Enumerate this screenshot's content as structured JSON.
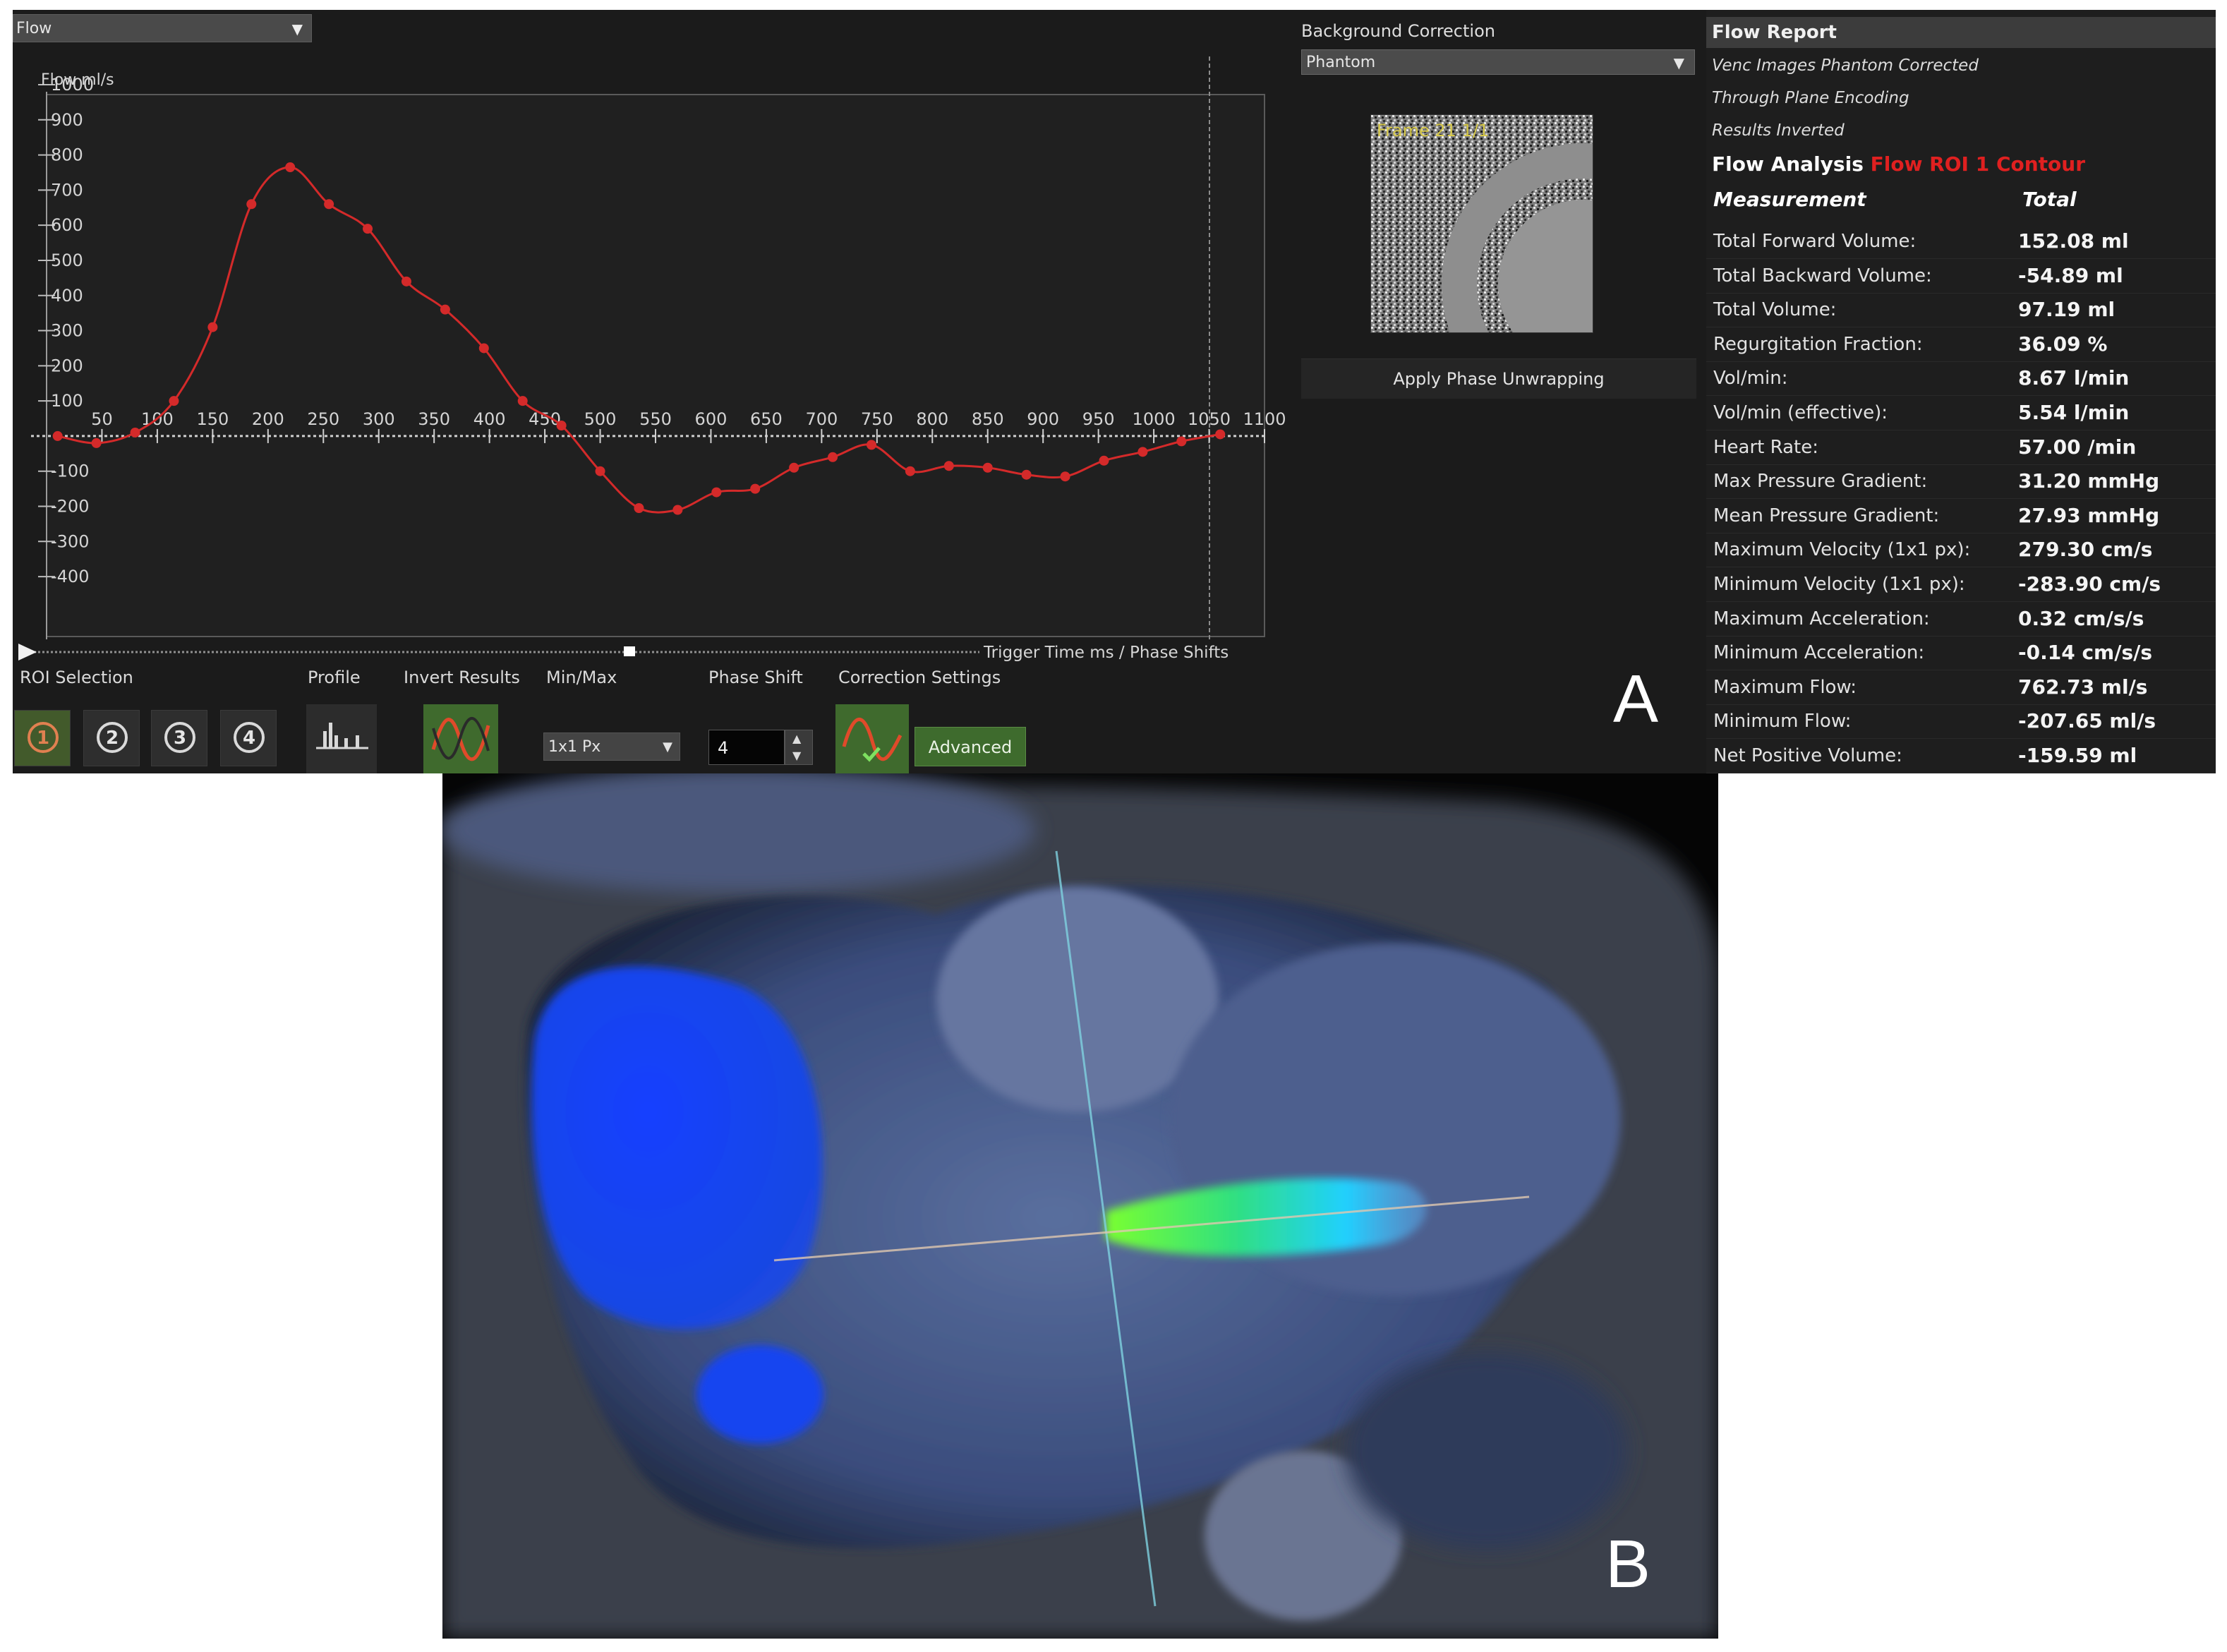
{
  "mode_select": {
    "value": "Flow"
  },
  "chart_data": {
    "type": "line",
    "title": "",
    "ylabel": "Flow ml/s",
    "xlabel": "Trigger Time ms / Phase Shifts",
    "xlim": [
      0,
      1100
    ],
    "ylim": [
      -450,
      1000
    ],
    "x_ticks": [
      50,
      100,
      150,
      200,
      250,
      300,
      350,
      400,
      450,
      500,
      550,
      600,
      650,
      700,
      750,
      800,
      850,
      900,
      950,
      1000,
      1050,
      1100
    ],
    "x_tick_labels": [
      "50",
      "100",
      "150",
      "200",
      "250",
      "300",
      "350",
      "400",
      "450",
      "500",
      "550",
      "600",
      "650",
      "700",
      "750",
      "800",
      "850",
      "900",
      "950",
      "1000",
      "1050",
      "1100"
    ],
    "y_ticks": [
      1000,
      900,
      800,
      700,
      600,
      500,
      400,
      300,
      200,
      100,
      -100,
      -200,
      -300,
      -400
    ],
    "y_tick_labels": [
      "1000",
      "900",
      "800",
      "700",
      "600",
      "500",
      "400",
      "300",
      "200",
      "100",
      "-100",
      "-200",
      "-300",
      "-400"
    ],
    "series": [
      {
        "color": "#d42a2a",
        "x": [
          10,
          45,
          80,
          115,
          150,
          185,
          220,
          255,
          290,
          325,
          360,
          395,
          430,
          465,
          500,
          535,
          570,
          605,
          640,
          675,
          710,
          745,
          780,
          815,
          850,
          885,
          920,
          955,
          990,
          1025,
          1060
        ],
        "values": [
          0,
          -20,
          10,
          100,
          310,
          660,
          765,
          660,
          590,
          440,
          360,
          250,
          100,
          30,
          -100,
          -205,
          -210,
          -160,
          -150,
          -90,
          -60,
          -25,
          -100,
          -85,
          -90,
          -110,
          -115,
          -70,
          -45,
          -15,
          5
        ]
      }
    ],
    "grid": false,
    "legend": "none"
  },
  "bg_correction": {
    "label": "Background Correction",
    "value": "Phantom",
    "thumb_label": "Frame 21 1/1",
    "unwrap_button": "Apply Phase Unwrapping"
  },
  "report": {
    "title": "Flow Report",
    "notes": [
      "Venc Images Phantom Corrected",
      "Through Plane Encoding",
      "Results Inverted"
    ],
    "analysis_label": "Flow Analysis",
    "analysis_roi": "Flow ROI 1 Contour",
    "col_measurement": "Measurement",
    "col_total": "Total",
    "rows": [
      {
        "label": "Total Forward Volume:",
        "value": "152.08 ml"
      },
      {
        "label": "Total Backward Volume:",
        "value": "-54.89 ml"
      },
      {
        "label": "Total Volume:",
        "value": "97.19 ml"
      },
      {
        "label": "Regurgitation Fraction:",
        "value": "36.09 %"
      },
      {
        "label": "Vol/min:",
        "value": "8.67 l/min"
      },
      {
        "label": "Vol/min (effective):",
        "value": "5.54 l/min"
      },
      {
        "label": "Heart Rate:",
        "value": "57.00 /min"
      },
      {
        "label": "Max Pressure Gradient:",
        "value": "31.20 mmHg"
      },
      {
        "label": "Mean Pressure Gradient:",
        "value": "27.93 mmHg"
      },
      {
        "label": "Maximum Velocity (1x1 px):",
        "value": "279.30 cm/s"
      },
      {
        "label": "Minimum Velocity (1x1 px):",
        "value": "-283.90 cm/s"
      },
      {
        "label": "Maximum Acceleration:",
        "value": "0.32 cm/s/s"
      },
      {
        "label": "Minimum Acceleration:",
        "value": "-0.14 cm/s/s"
      },
      {
        "label": "Maximum Flow:",
        "value": "762.73 ml/s"
      },
      {
        "label": "Minimum Flow:",
        "value": "-207.65 ml/s"
      },
      {
        "label": "Net Positive Volume:",
        "value": "-159.59 ml"
      }
    ]
  },
  "toolbar": {
    "roi_label": "ROI Selection",
    "roi_buttons": [
      "1",
      "2",
      "3",
      "4"
    ],
    "profile_label": "Profile",
    "invert_label": "Invert Results",
    "minmax_label": "Min/Max",
    "minmax_value": "1x1 Px",
    "phase_label": "Phase Shift",
    "phase_value": "4",
    "correction_label": "Correction Settings",
    "advanced_label": "Advanced"
  },
  "panel_labels": {
    "a": "A",
    "b": "B"
  }
}
